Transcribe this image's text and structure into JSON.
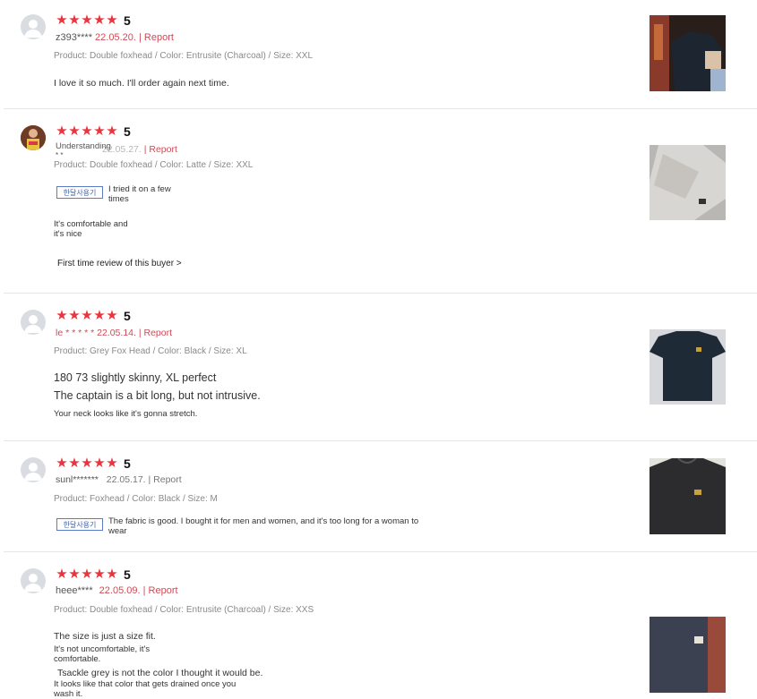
{
  "reviews": [
    {
      "rating": "5",
      "user": "z393****",
      "date": "22.05.20.",
      "separator": "|",
      "report": "Report",
      "product": "Product: Double foxhead / Color: Entrusite (Charcoal) / Size: XXL",
      "text": "I love it so much. I'll order again next time.",
      "photo_colors": {
        "bg": "#8a3a2a",
        "shirt": "#1d2530",
        "skin": "#d9c2a8"
      }
    },
    {
      "rating": "5",
      "user": "Understanding",
      "user2": "* *",
      "date": "22.05.27.",
      "separator": "|",
      "report": "Report",
      "product": "Product: Double foxhead / Color: Latte / Size: XXL",
      "badge": "한달사용기",
      "badge_text_1": "I tried it on a few",
      "badge_text_2": "times",
      "text_1": "It's comfortable and",
      "text_2": "it's nice",
      "link": "First time review of this buyer >",
      "photo_colors": {
        "bg": "#b9b7b3",
        "shirt": "#d8d6d2",
        "skin": "#7a7670"
      }
    },
    {
      "rating": "5",
      "user": "le * * * * *",
      "date": "22.05.14.",
      "separator": "|",
      "report": "Report",
      "product": "Product: Grey Fox Head / Color: Black / Size: XL",
      "text_1": "180 73 slightly skinny, XL perfect",
      "text_2": "The captain is a bit long, but not intrusive.",
      "text_3": "Your neck looks like it's gonna stretch.",
      "photo_colors": {
        "bg": "#d7d9dc",
        "shirt": "#1e2a36",
        "skin": "#c8a03a"
      }
    },
    {
      "rating": "5",
      "user": "sunl*******",
      "date": "22.05.17.",
      "separator": "|",
      "report": "Report",
      "product": "Product: Foxhead / Color: Black / Size: M",
      "badge": "한달사용기",
      "badge_text_1": "The fabric is good. I bought it for men and women, and it's too long for a woman to",
      "badge_text_2": "wear",
      "photo_colors": {
        "bg": "#e4e2dd",
        "shirt": "#2c2c2e",
        "skin": "#c9a23c"
      }
    },
    {
      "rating": "5",
      "user": "heee****",
      "date": "22.05.09.",
      "separator": "|",
      "report": "Report",
      "product": "Product: Double foxhead / Color: Entrusite (Charcoal) / Size: XXS",
      "text_1": "The size is just a size fit.",
      "text_2": "It's not uncomfortable, it's",
      "text_3": "comfortable.",
      "text_4": "Tsackle grey is not the color I thought it would be.",
      "text_5": "It looks like that color that gets drained once you",
      "text_6": "wash it.",
      "photo_colors": {
        "bg": "#9a4a3a",
        "shirt": "#3b4150",
        "skin": "#e8e2d8"
      }
    }
  ]
}
